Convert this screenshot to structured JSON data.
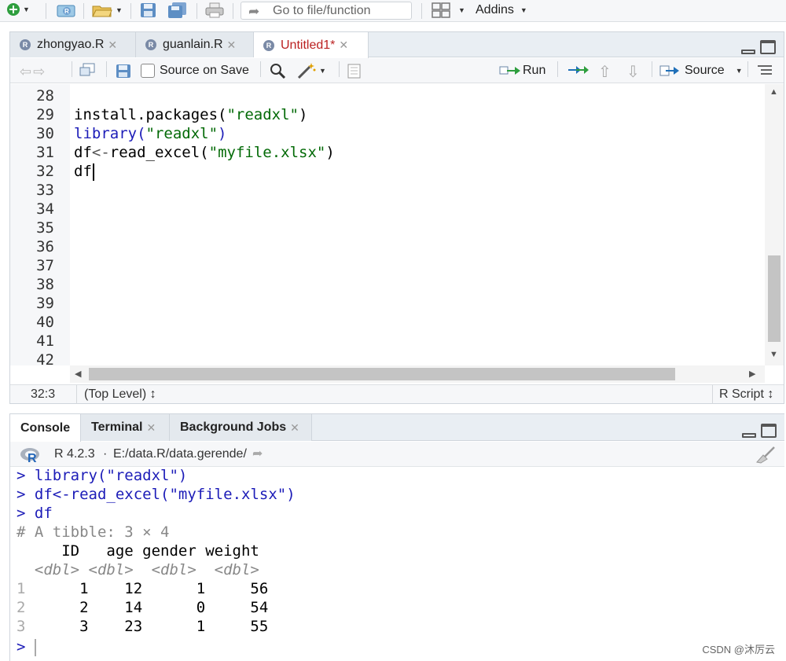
{
  "main_toolbar": {
    "goto_placeholder": "Go to file/function",
    "addins_label": "Addins"
  },
  "editor": {
    "tabs": [
      {
        "label": "zhongyao.R",
        "active": false
      },
      {
        "label": "guanlain.R",
        "active": false
      },
      {
        "label": "Untitled1*",
        "active": true
      }
    ],
    "toolbar": {
      "source_on_save_label": "Source on Save",
      "run_label": "Run",
      "source_label": "Source"
    },
    "line_numbers": [
      "28",
      "29",
      "30",
      "31",
      "32",
      "33",
      "34",
      "35",
      "36",
      "37",
      "38",
      "39",
      "40",
      "41",
      "42"
    ],
    "code": {
      "l29_a": "install.packages(",
      "l29_b": "\"readxl\"",
      "l29_c": ")",
      "l30_a": "library(",
      "l30_b": "\"readxl\"",
      "l30_c": ")",
      "l31_a": "df",
      "l31_b": "<-",
      "l31_c": "read_excel(",
      "l31_d": "\"myfile.xlsx\"",
      "l31_e": ")",
      "l32_a": "df"
    },
    "status": {
      "position": "32:3",
      "scope": "(Top Level) ↕",
      "filetype": "R Script ↕"
    }
  },
  "console": {
    "tabs": [
      {
        "label": "Console",
        "active": true
      },
      {
        "label": "Terminal",
        "active": false
      },
      {
        "label": "Background Jobs",
        "active": false
      }
    ],
    "r_version": "R 4.2.3",
    "separator": "·",
    "working_dir": "E:/data.R/data.gerende/",
    "prompt": ">",
    "lines": {
      "cmd1": "library(\"readxl\")",
      "cmd2": "df<-read_excel(\"myfile.xlsx\")",
      "cmd3": "df",
      "tibble_comment": "# A tibble: 3 × 4",
      "header": "     ID   age gender weight",
      "types": "  <dbl> <dbl>  <dbl>  <dbl>"
    },
    "table": {
      "columns": [
        "ID",
        "age",
        "gender",
        "weight"
      ],
      "rows": [
        {
          "n": "1",
          "vals": "      1    12      1     56"
        },
        {
          "n": "2",
          "vals": "      2    14      0     54"
        },
        {
          "n": "3",
          "vals": "      3    23      1     55"
        }
      ]
    }
  },
  "watermark": "CSDN @沐厉云",
  "colors": {
    "string": "#036a07",
    "keyword": "#1c1cb8",
    "active_tab_text": "#b22222"
  }
}
